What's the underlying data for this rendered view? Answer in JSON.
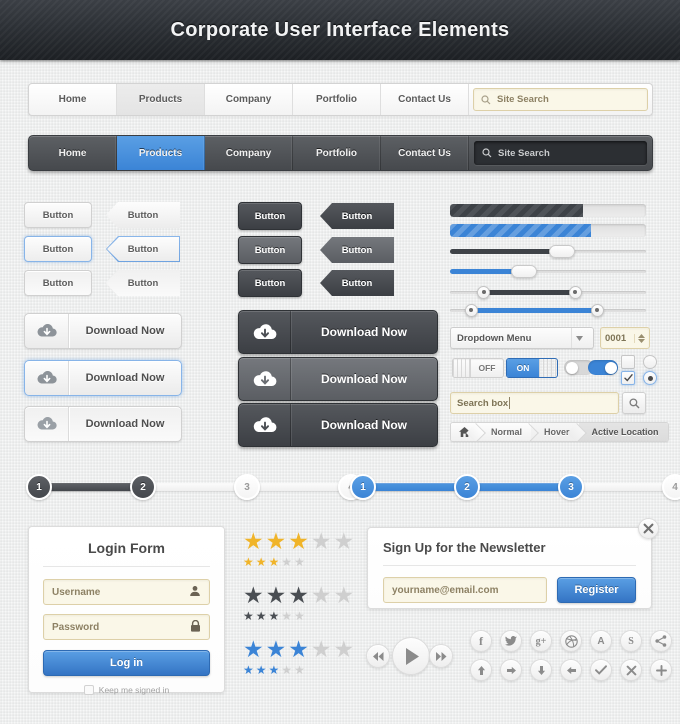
{
  "header": {
    "title": "Corporate User Interface Elements"
  },
  "light_nav": {
    "tabs": [
      {
        "label": "Home",
        "active": false
      },
      {
        "label": "Products",
        "active": true
      },
      {
        "label": "Company",
        "active": false
      },
      {
        "label": "Portfolio",
        "active": false
      },
      {
        "label": "Contact Us",
        "active": false
      }
    ],
    "search_placeholder": "Site Search",
    "search_icon": "search-icon"
  },
  "dark_nav": {
    "tabs": [
      {
        "label": "Home",
        "active": false
      },
      {
        "label": "Products",
        "active": true
      },
      {
        "label": "Company",
        "active": false
      },
      {
        "label": "Portfolio",
        "active": false
      },
      {
        "label": "Contact Us",
        "active": false
      }
    ],
    "search_placeholder": "Site Search",
    "search_icon": "search-icon"
  },
  "buttons": {
    "label": "Button",
    "light_states": [
      "normal",
      "selected",
      "pressed"
    ],
    "dark_states": [
      "normal",
      "hover",
      "pressed"
    ]
  },
  "download": {
    "label": "Download Now",
    "icon": "cloud-download-icon",
    "states": [
      "normal",
      "selected",
      "pressed"
    ]
  },
  "progress": [
    {
      "style": "dark",
      "percent": 68
    },
    {
      "style": "blue",
      "percent": 72
    }
  ],
  "sliders": [
    {
      "style": "dark",
      "value": 58
    },
    {
      "style": "blue",
      "value": 36
    }
  ],
  "ranges": [
    {
      "style": "dark",
      "from": 15,
      "to": 65
    },
    {
      "style": "blue",
      "from": 8,
      "to": 77
    }
  ],
  "form_controls": {
    "dropdown_value": "Dropdown Menu",
    "dropdown_icon": "chevron-down-icon",
    "stepper_value": "0001",
    "stepper_icon": "updown-arrows-icon",
    "toggle_off_label": "OFF",
    "toggle_on_label": "ON",
    "checkbox_icon": "check-icon",
    "radio_icon": "radio-dot-icon"
  },
  "search_widget": {
    "value": "Search box",
    "button_icon": "search-icon"
  },
  "breadcrumb": {
    "home_icon": "home-icon",
    "items": [
      {
        "label": "Normal",
        "state": "normal"
      },
      {
        "label": "Hover",
        "state": "hover"
      },
      {
        "label": "Active Location",
        "state": "active"
      }
    ]
  },
  "steps_dark": {
    "nodes": [
      {
        "label": "1",
        "done": true
      },
      {
        "label": "2",
        "done": true
      },
      {
        "label": "3",
        "done": false
      },
      {
        "label": "4",
        "done": false
      }
    ]
  },
  "steps_blue": {
    "nodes": [
      {
        "label": "1",
        "done": true
      },
      {
        "label": "2",
        "done": true
      },
      {
        "label": "3",
        "done": true
      },
      {
        "label": "4",
        "done": false
      }
    ]
  },
  "login": {
    "title": "Login Form",
    "username_placeholder": "Username",
    "username_icon": "user-icon",
    "password_placeholder": "Password",
    "password_icon": "lock-icon",
    "submit_label": "Log in",
    "remember_label": "Keep me signed in"
  },
  "ratings": [
    {
      "color_name": "gold",
      "color": "#f0b429",
      "filled": 3,
      "total": 5
    },
    {
      "color_name": "dark",
      "color": "#4a4e53",
      "filled": 3,
      "total": 5
    },
    {
      "color_name": "blue",
      "color": "#3b84d6",
      "filled": 3,
      "total": 5
    }
  ],
  "star_empty_color": "#cfcfcf",
  "newsletter": {
    "title": "Sign Up for the Newsletter",
    "email_placeholder": "yourname@email.com",
    "button_label": "Register",
    "close_icon": "close-icon"
  },
  "media_buttons": [
    {
      "icon": "rewind-icon"
    },
    {
      "icon": "play-icon"
    },
    {
      "icon": "fast-forward-icon"
    }
  ],
  "social_buttons": [
    {
      "icon": "facebook-icon",
      "glyph": "f"
    },
    {
      "icon": "twitter-icon",
      "glyph": "t"
    },
    {
      "icon": "google-plus-icon",
      "glyph": "g+"
    },
    {
      "icon": "dribbble-icon",
      "glyph": "d"
    },
    {
      "icon": "behance-icon",
      "glyph": "A"
    },
    {
      "icon": "skype-icon",
      "glyph": "S"
    },
    {
      "icon": "share-icon",
      "glyph": "<"
    }
  ],
  "action_buttons": [
    {
      "icon": "arrow-up-icon"
    },
    {
      "icon": "arrow-right-icon"
    },
    {
      "icon": "arrow-down-icon"
    },
    {
      "icon": "arrow-left-icon"
    },
    {
      "icon": "check-icon"
    },
    {
      "icon": "close-icon"
    },
    {
      "icon": "plus-icon"
    }
  ],
  "colors": {
    "accent_blue": "#3b84d6",
    "dark": "#44474c",
    "cream": "#faf7e8",
    "gold": "#f0b429"
  }
}
